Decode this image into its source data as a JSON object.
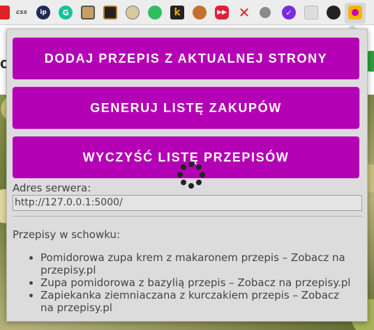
{
  "toolbar": {
    "extensions": [
      {
        "icon": "red-square-icon",
        "text": ""
      },
      {
        "icon": "css-icon",
        "text": "css"
      },
      {
        "icon": "ip-icon",
        "text": "ip"
      },
      {
        "icon": "grammarly-icon",
        "text": "G"
      },
      {
        "icon": "box-face-icon",
        "text": ""
      },
      {
        "icon": "gear-square-icon",
        "text": ""
      },
      {
        "icon": "eyes-icon",
        "text": ""
      },
      {
        "icon": "evernote-icon",
        "text": ""
      },
      {
        "icon": "k-icon",
        "text": "k"
      },
      {
        "icon": "onion-icon",
        "text": ""
      },
      {
        "icon": "forward-icon",
        "text": ""
      },
      {
        "icon": "red-x-icon",
        "text": "✕"
      },
      {
        "icon": "gray-circle-icon",
        "text": ""
      },
      {
        "icon": "purple-check-icon",
        "text": ""
      },
      {
        "icon": "grid-icon",
        "text": ""
      },
      {
        "icon": "github-icon",
        "text": ""
      },
      {
        "icon": "recipe-extension-icon",
        "text": ""
      }
    ]
  },
  "popup": {
    "btn_add": "DODAJ PRZEPIS Z AKTUALNEJ STRONY",
    "btn_generate": "GENERUJ LISTĘ ZAKUPÓW",
    "btn_clear": "WYCZYŚĆ LISTĘ PRZEPISÓW",
    "server_label": "Adres serwera:",
    "server_value": "http://127.0.0.1:5000/",
    "list_title": "Przepisy w schowku:",
    "recipes": [
      "Pomidorowa zupa krem z makaronem przepis – Zobacz na przepisy.pl",
      "Zupa pomidorowa z bazylią przepis – Zobacz na przepisy.pl",
      "Zapiekanka ziemniaczana z kurczakiem przepis – Zobacz na przepisy.pl"
    ]
  },
  "background": {
    "partial_text": "o"
  },
  "colors": {
    "accent": "#b400b4",
    "popup_bg": "#dcdcdc",
    "text": "#444444"
  }
}
